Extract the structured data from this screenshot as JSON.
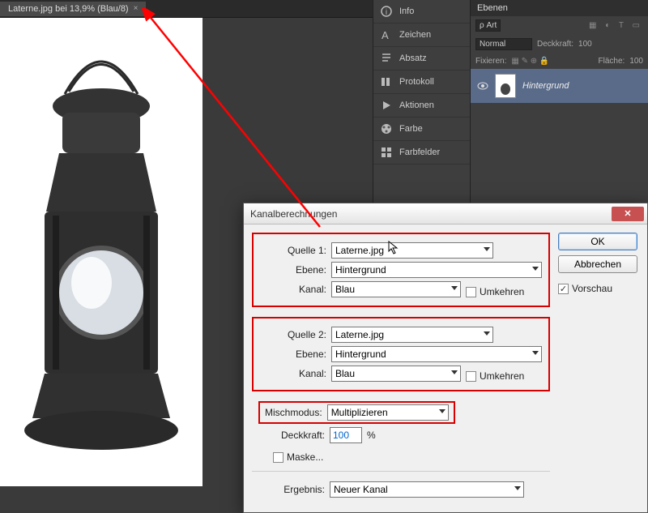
{
  "tab": {
    "title": "Laterne.jpg bei 13,9% (Blau/8)",
    "close": "×"
  },
  "panels1": [
    {
      "icon": "info-icon",
      "label": "Info"
    },
    {
      "icon": "char-icon",
      "label": "Zeichen"
    },
    {
      "icon": "para-icon",
      "label": "Absatz"
    },
    {
      "icon": "history-icon",
      "label": "Protokoll"
    },
    {
      "icon": "actions-icon",
      "label": "Aktionen"
    },
    {
      "icon": "color-icon",
      "label": "Farbe"
    },
    {
      "icon": "swatch-icon",
      "label": "Farbfelder"
    }
  ],
  "layers": {
    "title": "Ebenen",
    "filter_label": "ρ Art",
    "blend": "Normal",
    "opacity_label": "Deckkraft:",
    "opacity_val": "100",
    "lock_label": "Fixieren:",
    "fill_label": "Fläche:",
    "fill_val": "100",
    "layer_name": "Hintergrund"
  },
  "dialog": {
    "title": "Kanalberechnungen",
    "ok": "OK",
    "cancel": "Abbrechen",
    "preview": "Vorschau",
    "src1": {
      "label": "Quelle 1:",
      "value": "Laterne.jpg",
      "layer_label": "Ebene:",
      "layer": "Hintergrund",
      "chan_label": "Kanal:",
      "chan": "Blau",
      "invert": "Umkehren"
    },
    "src2": {
      "label": "Quelle 2:",
      "value": "Laterne.jpg",
      "layer_label": "Ebene:",
      "layer": "Hintergrund",
      "chan_label": "Kanal:",
      "chan": "Blau",
      "invert": "Umkehren"
    },
    "blend": {
      "label": "Mischmodus:",
      "value": "Multiplizieren"
    },
    "opacity": {
      "label": "Deckkraft:",
      "value": "100",
      "pct": "%"
    },
    "mask": "Maske...",
    "result": {
      "label": "Ergebnis:",
      "value": "Neuer Kanal"
    }
  }
}
